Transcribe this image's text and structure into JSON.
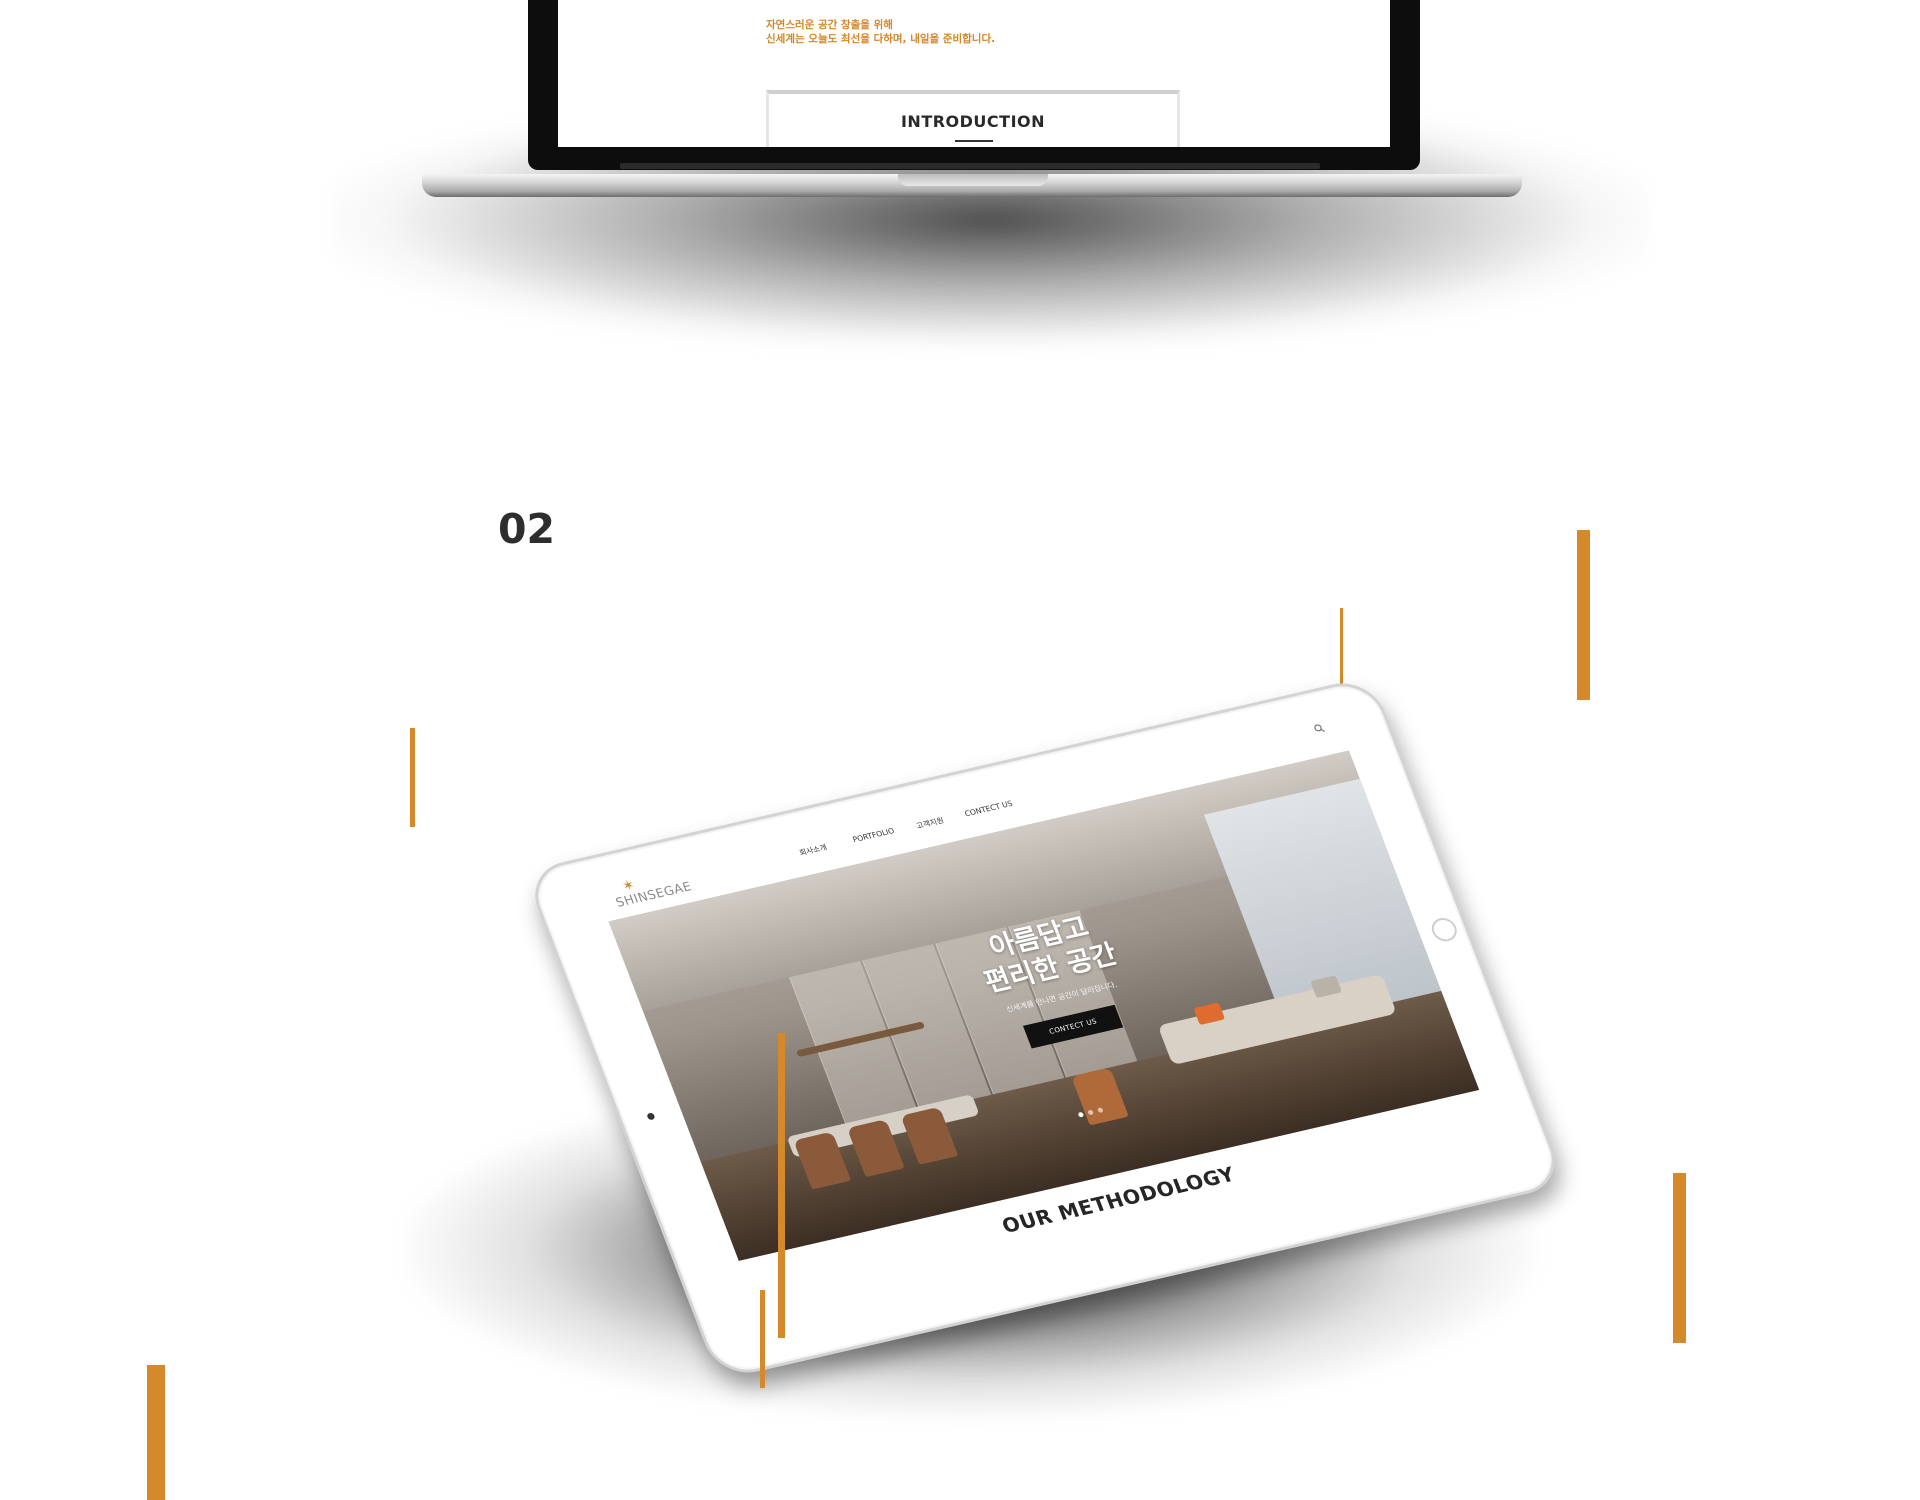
{
  "laptop": {
    "copy_line_1": "자연스러운 공간 창출을 위해",
    "copy_line_2": "신세계는 오늘도 최선을 다하며, 내일을 준비합니다.",
    "intro_title": "INTRODUCTION"
  },
  "section": {
    "number": "02"
  },
  "tablet": {
    "logo_text": "SHINSEGAE",
    "logo_mark": "✶",
    "nav": [
      "회사소개",
      "PORTFOLIO",
      "고객지원",
      "CONTECT US"
    ],
    "hero_title": "아름답고\n편리한 공간",
    "hero_subtitle": "신세계를 만나면 공간이 달라집니다.",
    "hero_button": "CONTECT US",
    "section_title": "OUR METHODOLOGY"
  },
  "colors": {
    "accent": "#d48a2b",
    "text_dark": "#2e2e2e"
  },
  "icons": [
    "search-icon",
    "logo-icon",
    "home-button-icon",
    "camera-icon"
  ]
}
